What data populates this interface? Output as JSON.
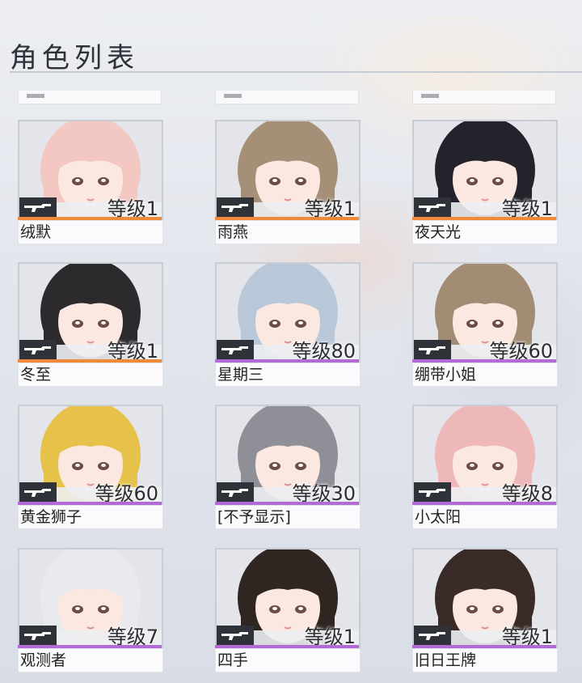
{
  "header": {
    "title": "角色列表"
  },
  "characters": [
    {
      "name": "绒默",
      "level": "等级1",
      "hair": "#f3c7c2",
      "rarity": "orange",
      "weapon": "gun-icon"
    },
    {
      "name": "雨燕",
      "level": "等级1",
      "hair": "#a58f77",
      "rarity": "orange",
      "weapon": "gun-icon"
    },
    {
      "name": "夜天光",
      "level": "等级1",
      "hair": "#24222a",
      "rarity": "orange",
      "weapon": "gun-icon"
    },
    {
      "name": "冬至",
      "level": "等级1",
      "hair": "#2d2a2e",
      "rarity": "orange",
      "weapon": "gun-icon"
    },
    {
      "name": "星期三",
      "level": "等级80",
      "hair": "#b9c8d8",
      "rarity": "purple",
      "weapon": "gun-icon"
    },
    {
      "name": "绷带小姐",
      "level": "等级60",
      "hair": "#a28d74",
      "rarity": "purple",
      "weapon": "gun-icon"
    },
    {
      "name": "黄金狮子",
      "level": "等级60",
      "hair": "#e6c24a",
      "rarity": "purple",
      "weapon": "gun-icon"
    },
    {
      "name": "[不予显示]",
      "level": "等级30",
      "hair": "#8f9097",
      "rarity": "purple",
      "weapon": "gun-icon"
    },
    {
      "name": "小太阳",
      "level": "等级8",
      "hair": "#efb8b8",
      "rarity": "purple",
      "weapon": "gun-icon"
    },
    {
      "name": "观测者",
      "level": "等级7",
      "hair": "#e9eaee",
      "rarity": "purple",
      "weapon": "gun-icon"
    },
    {
      "name": "四手",
      "level": "等级1",
      "hair": "#2f2621",
      "rarity": "purple",
      "weapon": "gun-icon"
    },
    {
      "name": "旧日王牌",
      "level": "等级1",
      "hair": "#3a2a28",
      "rarity": "purple",
      "weapon": "gun-icon"
    }
  ]
}
